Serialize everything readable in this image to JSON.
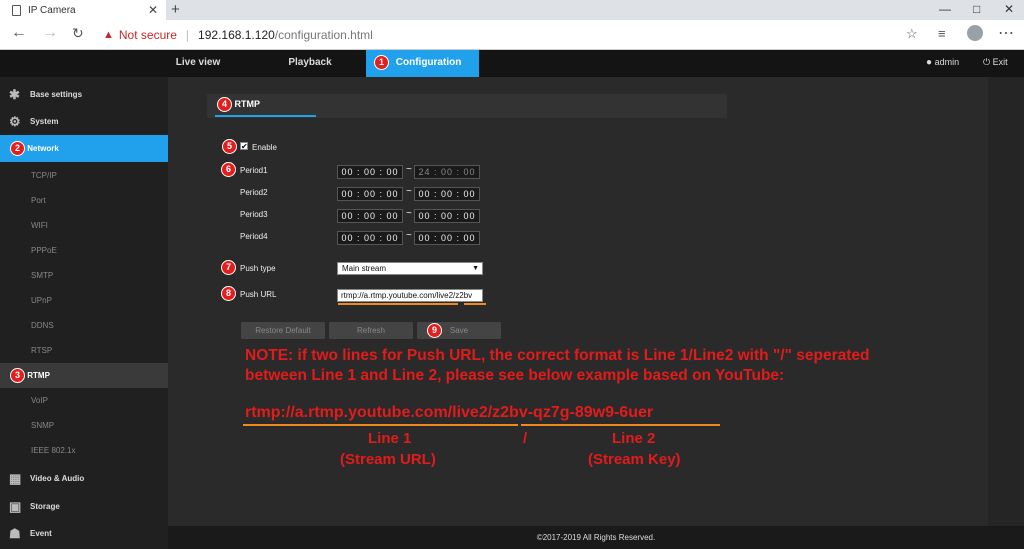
{
  "browser": {
    "tab_title": "IP Camera",
    "new_tab": "+",
    "tab_close": "✕",
    "min": "—",
    "max": "□",
    "close": "✕",
    "warn": "▲",
    "not_secure": "Not secure",
    "separator": "|",
    "host": "192.168.1.120",
    "path": "/configuration.html"
  },
  "topnav": {
    "live": "Live view",
    "playback": "Playback",
    "config": "Configuration",
    "config_badge": "1",
    "user": "admin",
    "exit": "Exit"
  },
  "sidebar": {
    "base": "Base settings",
    "system": "System",
    "network": "Network",
    "network_badge": "2",
    "subs": [
      "TCP/IP",
      "Port",
      "WIFI",
      "PPPoE",
      "SMTP",
      "UPnP",
      "DDNS",
      "RTSP"
    ],
    "rtmp": "RTMP",
    "rtmp_badge": "3",
    "subs2": [
      "VoIP",
      "SNMP",
      "IEEE 802.1x"
    ],
    "video": "Video & Audio",
    "storage": "Storage",
    "event": "Event"
  },
  "panel": {
    "title": "RTMP",
    "title_badge": "4"
  },
  "form": {
    "enable": "Enable",
    "enable_badge": "5",
    "period1": "Period1",
    "period1_badge": "6",
    "period2": "Period2",
    "period3": "Period3",
    "period4": "Period4",
    "p1_start": "00 : 00 : 00",
    "p1_end": "24 : 00 : 00",
    "p2_start": "00 : 00 : 00",
    "p2_end": "00 : 00 : 00",
    "p3_start": "00 : 00 : 00",
    "p3_end": "00 : 00 : 00",
    "p4_start": "00 : 00 : 00",
    "p4_end": "00 : 00 : 00",
    "tilde": "~",
    "push_type": "Push type",
    "push_type_badge": "7",
    "push_type_value": "Main stream",
    "push_url": "Push URL",
    "push_url_badge": "8",
    "push_url_value": "rtmp://a.rtmp.youtube.com/live2/z2bv",
    "restore": "Restore Default",
    "refresh": "Refresh",
    "save": "Save",
    "save_badge": "9"
  },
  "note": {
    "line_a": "NOTE: if two lines for Push URL, the correct format is Line 1/Line2 with \"/\" seperated",
    "line_b": "between Line 1 and Line 2, please see below example based on YouTube:",
    "example": "rtmp://a.rtmp.youtube.com/live2/z2bv-qz7g-89w9-6uer",
    "line1": "Line 1",
    "stream_url": "(Stream URL)",
    "slash": "/",
    "line2": "Line 2",
    "stream_key": "(Stream Key)"
  },
  "footer": "©2017-2019 All Rights Reserved.",
  "colors": {
    "accent": "#21a1ec",
    "annotation": "#e21b1b",
    "underline": "#f08a1f"
  }
}
